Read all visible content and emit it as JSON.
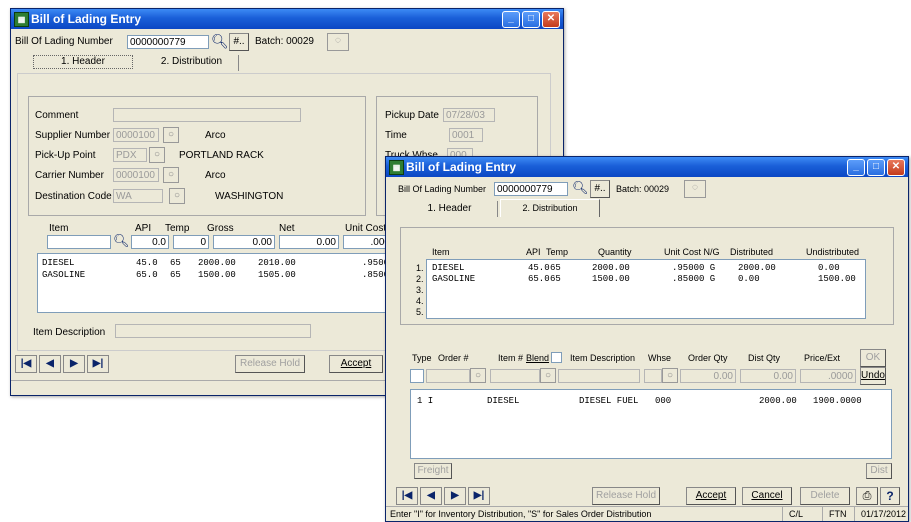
{
  "win1": {
    "title": "Bill of Lading Entry",
    "bol_label": "Bill Of Lading Number",
    "bol_value": "0000000779",
    "hash_label": "#..",
    "batch_label": "Batch: 00029",
    "tabs": [
      {
        "label": "1. Header"
      },
      {
        "label": "2. Distribution"
      }
    ],
    "comment_label": "Comment",
    "comment_value": "",
    "supplier_label": "Supplier Number",
    "supplier_value": "0000100",
    "supplier_name": "Arco",
    "pickup_point_label": "Pick-Up Point",
    "pickup_point_value": "PDX",
    "pickup_point_name": "PORTLAND RACK",
    "carrier_label": "Carrier Number",
    "carrier_value": "0000100",
    "carrier_name": "Arco",
    "dest_label": "Destination Code",
    "dest_value": "WA",
    "dest_name": "WASHINGTON",
    "pickup_date_label": "Pickup Date",
    "pickup_date_value": "07/28/03",
    "time_label": "Time",
    "time_value": "0001",
    "truck_label": "Truck Whse",
    "truck_value": "000",
    "grid_headers": {
      "item": "Item",
      "api": "API",
      "temp": "Temp",
      "gross": "Gross",
      "net": "Net",
      "unit_cost": "Unit Cost"
    },
    "entry": {
      "api": "0.0",
      "temp": "0",
      "gross": "0.00",
      "net": "0.00",
      "unit_cost": ".000"
    },
    "rows": [
      {
        "item": "DIESEL",
        "api": "45.0",
        "temp": "65",
        "gross": "2000.00",
        "net": "2010.00",
        "unit_cost": ".9500"
      },
      {
        "item": "GASOLINE",
        "api": "65.0",
        "temp": "65",
        "gross": "1500.00",
        "net": "1505.00",
        "unit_cost": ".8500"
      }
    ],
    "item_desc_label": "Item Description",
    "release_hold": "Release Hold",
    "accept": "Accept"
  },
  "win2": {
    "title": "Bill of Lading Entry",
    "bol_label": "Bill Of Lading Number",
    "bol_value": "0000000779",
    "hash_label": "#..",
    "batch_label": "Batch: 00029",
    "tabs": [
      {
        "label": "1. Header"
      },
      {
        "label": "2. Distribution"
      }
    ],
    "dist_headers": {
      "item": "Item",
      "api": "API",
      "temp": "Temp",
      "quantity": "Quantity",
      "unit_cost": "Unit Cost N/G",
      "distributed": "Distributed",
      "undistributed": "Undistributed"
    },
    "dist_rows": [
      {
        "num": "1.",
        "item": "DIESEL",
        "api": "45.0",
        "temp": "65",
        "qty": "2000.00",
        "cost": ".95000 G",
        "dist": "2000.00",
        "undist": "0.00"
      },
      {
        "num": "2.",
        "item": "GASOLINE",
        "api": "65.0",
        "temp": "65",
        "qty": "1500.00",
        "cost": ".85000 G",
        "dist": "0.00",
        "undist": "1500.00"
      },
      {
        "num": "3.",
        "item": "",
        "api": "",
        "temp": "",
        "qty": "",
        "cost": "",
        "dist": "",
        "undist": ""
      },
      {
        "num": "4.",
        "item": "",
        "api": "",
        "temp": "",
        "qty": "",
        "cost": "",
        "dist": "",
        "undist": ""
      },
      {
        "num": "5.",
        "item": "",
        "api": "",
        "temp": "",
        "qty": "",
        "cost": "",
        "dist": "",
        "undist": ""
      }
    ],
    "order_headers": {
      "type": "Type",
      "order": "Order #",
      "item": "Item #",
      "blend": "Blend",
      "desc": "Item Description",
      "whse": "Whse",
      "order_qty": "Order Qty",
      "dist_qty": "Dist Qty",
      "price": "Price/Ext"
    },
    "order_entry": {
      "order_qty": "0.00",
      "dist_qty": "0.00",
      "price": ".0000"
    },
    "ok_label": "OK",
    "undo_label": "Undo",
    "order_rows": [
      {
        "line": "1 I",
        "item": "DIESEL",
        "desc": "DIESEL FUEL",
        "whse": "000",
        "dist_qty": "2000.00",
        "price": "1900.0000"
      }
    ],
    "freight": "Freight",
    "dist": "Dist",
    "release_hold": "Release Hold",
    "accept": "Accept",
    "cancel": "Cancel",
    "delete": "Delete",
    "status_text": "Enter \"I\" for Inventory Distribution, \"S\" for Sales Order Distribution",
    "status_module": "C/L",
    "status_company": "FTN",
    "status_date": "01/17/2012"
  }
}
